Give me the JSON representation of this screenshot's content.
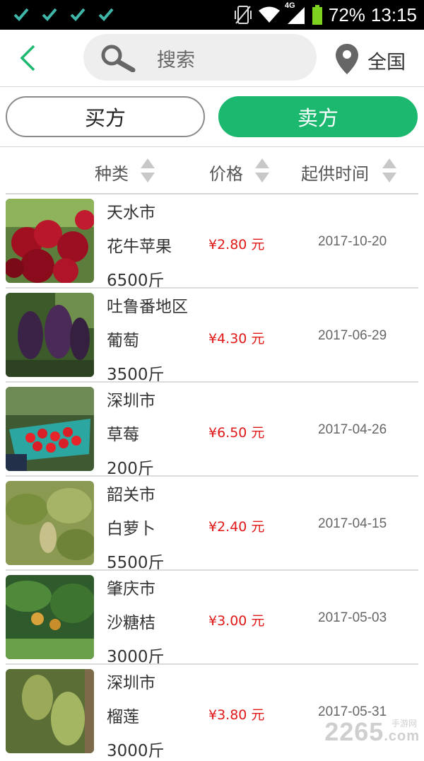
{
  "status_bar": {
    "icons": [
      "check-icon",
      "check-icon",
      "check-icon",
      "check-icon",
      "vibrate-icon",
      "wifi-icon",
      "signal-4g-icon",
      "battery-icon"
    ],
    "network": "4G",
    "battery": "72%",
    "time": "13:15"
  },
  "nav": {
    "search_placeholder": "搜索",
    "region": "全国"
  },
  "tabs": {
    "buyer": "买方",
    "seller": "卖方",
    "active": "seller"
  },
  "sort": {
    "category": "种类",
    "price": "价格",
    "start_date": "起供时间"
  },
  "colors": {
    "accent": "#1cb870",
    "price": "#e01818"
  },
  "listings": [
    {
      "place": "天水市",
      "name": "花牛苹果",
      "qty": "6500斤",
      "price": "¥2.80 元",
      "date": "2017-10-20",
      "image": "red-apples"
    },
    {
      "place": "吐鲁番地区",
      "name": "葡萄",
      "qty": "3500斤",
      "price": "¥4.30 元",
      "date": "2017-06-29",
      "image": "grapes"
    },
    {
      "place": "深圳市",
      "name": "草莓",
      "qty": "200斤",
      "price": "¥6.50 元",
      "date": "2017-04-26",
      "image": "strawberries"
    },
    {
      "place": "韶关市",
      "name": "白萝卜",
      "qty": "5500斤",
      "price": "¥2.40 元",
      "date": "2017-04-15",
      "image": "radish-field"
    },
    {
      "place": "肇庆市",
      "name": "沙糖桔",
      "qty": "3000斤",
      "price": "¥3.00 元",
      "date": "2017-05-03",
      "image": "tangerine-tree"
    },
    {
      "place": "深圳市",
      "name": "榴莲",
      "qty": "3000斤",
      "price": "¥3.80 元",
      "date": "2017-05-31",
      "image": "durians"
    }
  ],
  "watermark": {
    "text": "2265",
    "sub": "手游网",
    "suffix": ".com"
  }
}
